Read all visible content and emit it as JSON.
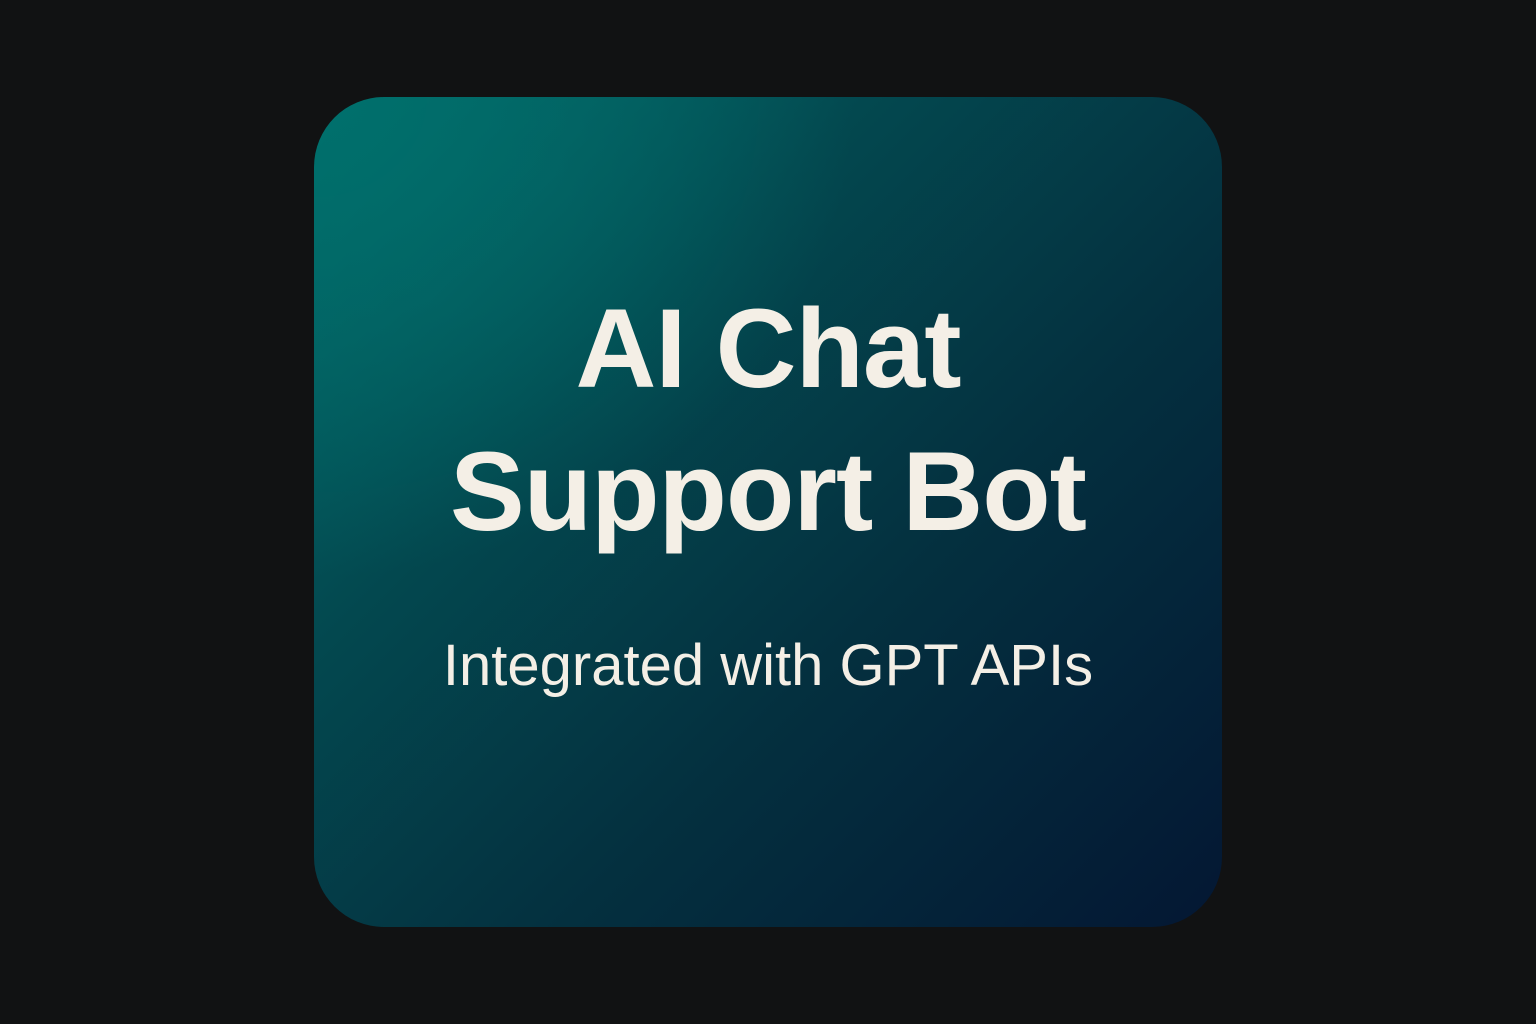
{
  "card": {
    "title_line1": "AI Chat",
    "title_line2": "Support Bot",
    "subtitle": "Integrated with GPT APIs",
    "colors": {
      "background": "#111213",
      "gradient_start": "#026a6a",
      "gradient_end": "#041733",
      "text": "#f4efe6"
    }
  }
}
